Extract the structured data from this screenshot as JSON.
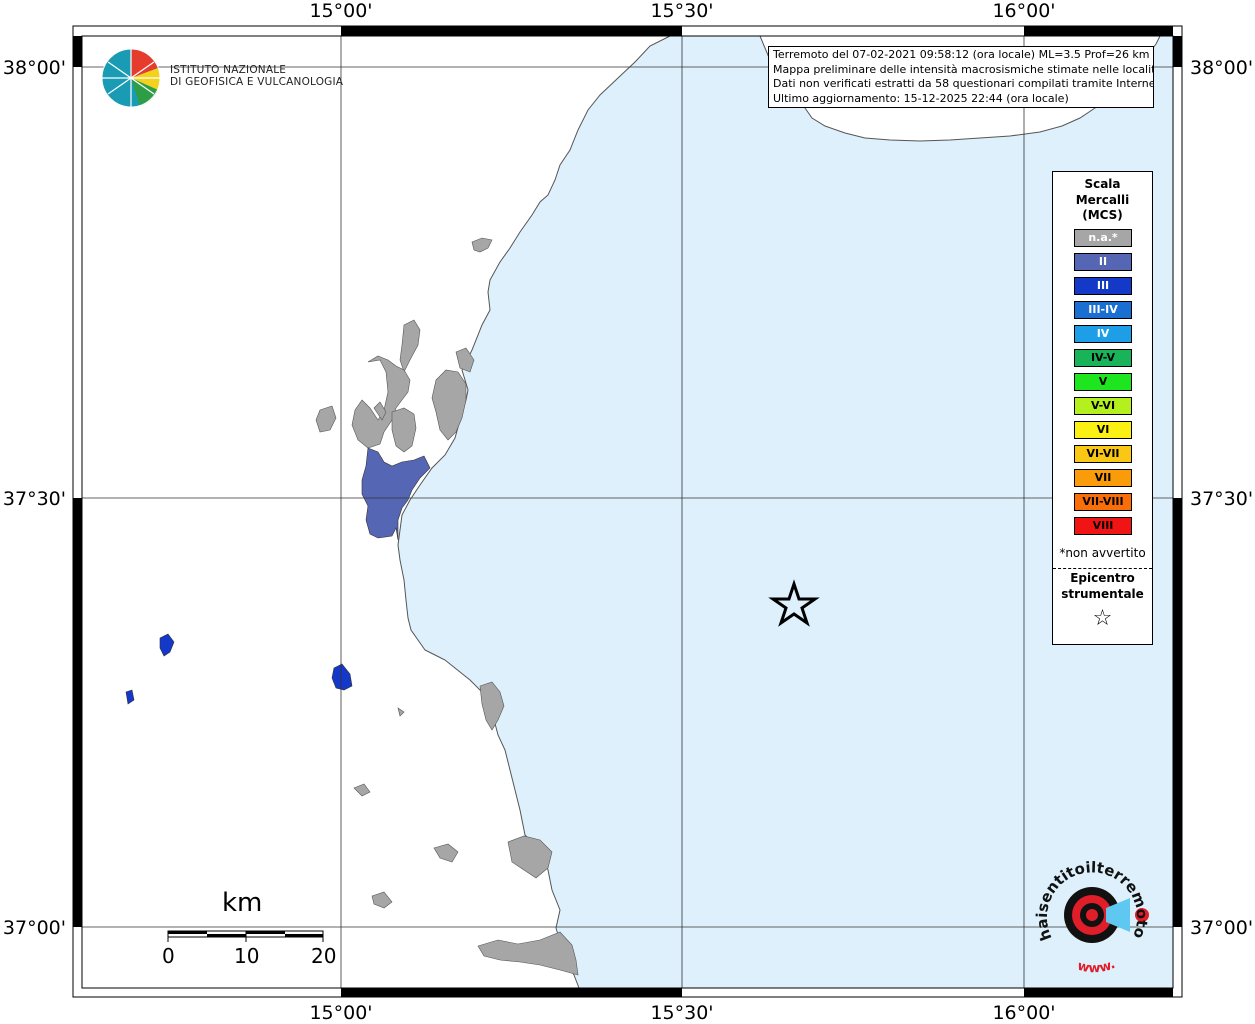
{
  "map": {
    "ticks": {
      "top": [
        "15°00'",
        "15°30'",
        "16°00'"
      ],
      "bottom": [
        "15°00'",
        "15°30'",
        "16°00'"
      ],
      "left": [
        "38°00'",
        "37°30'",
        "37°00'"
      ],
      "right": [
        "38°00'",
        "37°30'",
        "37°00'"
      ]
    },
    "colors": {
      "sea": "#ddf0fc",
      "land": "#ffffff",
      "not_felt": "#a6a6a6",
      "intensity_II": "#5566b4",
      "intensity_III": "#1438c8",
      "epicenter": "#000000"
    },
    "epicenter_icon": "star-icon"
  },
  "info": {
    "line1": "Terremoto del 07-02-2021 09:58:12 (ora locale) ML=3.5 Prof=26 km",
    "line2": "Mappa preliminare delle intensità macrosismiche stimate nelle località",
    "line3": "Dati non verificati estratti da 58 questionari compilati tramite Internet.",
    "line4": "Ultimo aggiornamento: 15-12-2025 22:44 (ora locale)"
  },
  "legend": {
    "title_line1": "Scala",
    "title_line2": "Mercalli",
    "title_line3": "(MCS)",
    "items": [
      {
        "label": "n.a.*",
        "color": "#a6a6a6",
        "text": "#ffffff"
      },
      {
        "label": "II",
        "color": "#5566b4",
        "text": "#ffffff"
      },
      {
        "label": "III",
        "color": "#1438c8",
        "text": "#ffffff"
      },
      {
        "label": "III-IV",
        "color": "#1a6fd0",
        "text": "#ffffff"
      },
      {
        "label": "IV",
        "color": "#1e9ee6",
        "text": "#ffffff"
      },
      {
        "label": "IV-V",
        "color": "#19b45a",
        "text": "#000000"
      },
      {
        "label": "V",
        "color": "#1ee61e",
        "text": "#000000"
      },
      {
        "label": "V-VI",
        "color": "#b4f01e",
        "text": "#000000"
      },
      {
        "label": "VI",
        "color": "#faf014",
        "text": "#000000"
      },
      {
        "label": "VI-VII",
        "color": "#fac814",
        "text": "#000000"
      },
      {
        "label": "VII",
        "color": "#fa9b0a",
        "text": "#000000"
      },
      {
        "label": "VII-VIII",
        "color": "#fa6e0a",
        "text": "#000000"
      },
      {
        "label": "VIII",
        "color": "#f01414",
        "text": "#000000"
      }
    ],
    "note": "*non avvertito",
    "epicenter_line1": "Epicentro",
    "epicenter_line2": "strumentale"
  },
  "ingv": {
    "line1": "ISTITUTO NAZIONALE",
    "line2": "DI GEOFISICA E VULCANOLOGIA"
  },
  "scale": {
    "unit": "km",
    "labels": [
      "0",
      "10",
      "20"
    ]
  },
  "hsit": {
    "text": "haisentitoilterremoto.it",
    "prefix": "www."
  }
}
